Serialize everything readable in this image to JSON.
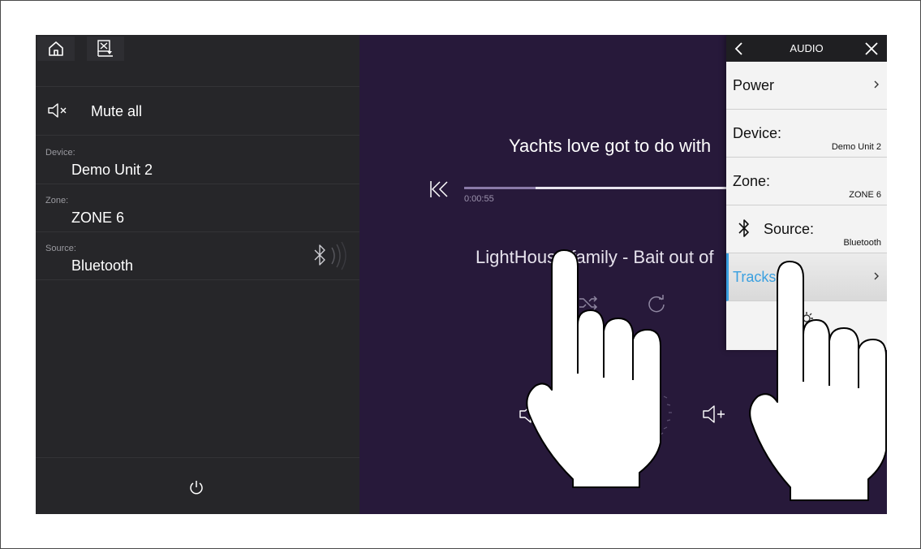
{
  "left_panel": {
    "mute_all_label": "Mute all",
    "device": {
      "label": "Device:",
      "value": "Demo Unit 2"
    },
    "zone": {
      "label": "Zone:",
      "value": "ZONE 6"
    },
    "source": {
      "label": "Source:",
      "value": "Bluetooth"
    }
  },
  "player": {
    "song_title": "Yachts love got to do with",
    "artist_line": "LightHouse family - Bait out of",
    "elapsed": "0:00:55",
    "progress_fraction": 0.27
  },
  "audio_menu": {
    "title": "AUDIO",
    "items": {
      "power": "Power",
      "device_label": "Device:",
      "device_value": "Demo Unit 2",
      "zone_label": "Zone:",
      "zone_value": "ZONE 6",
      "source_label": "Source:",
      "source_value": "Bluetooth",
      "tracks": "Tracks"
    }
  },
  "colors": {
    "screen_bg": "#27193a",
    "panel_bg": "#262629",
    "menu_bg": "#f3f3f3",
    "accent": "#3aa0e0"
  },
  "icons": [
    "home-icon",
    "no-chart-icon",
    "mute-icon",
    "bluetooth-icon",
    "power-icon",
    "previous-track-icon",
    "shuffle-icon",
    "repeat-icon",
    "volume-down-icon",
    "volume-up-icon",
    "back-icon",
    "close-icon",
    "chevron-right-icon"
  ]
}
